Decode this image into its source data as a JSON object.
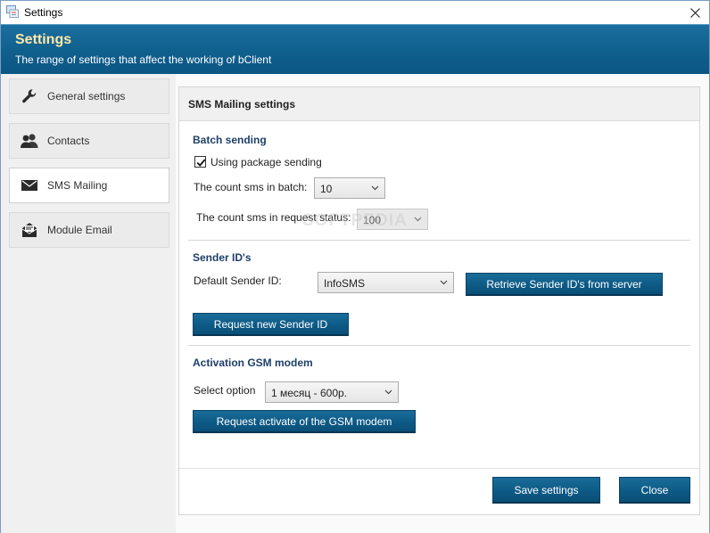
{
  "window": {
    "title": "Settings"
  },
  "banner": {
    "title": "Settings",
    "subtitle": "The range of settings that affect the working of bClient"
  },
  "sidebar": {
    "items": [
      {
        "label": "General settings",
        "icon": "wrench-icon",
        "active": false
      },
      {
        "label": "Contacts",
        "icon": "contacts-icon",
        "active": false
      },
      {
        "label": "SMS Mailing",
        "icon": "envelope-icon",
        "active": true
      },
      {
        "label": "Module Email",
        "icon": "email-module-icon",
        "active": false
      }
    ]
  },
  "panel": {
    "header": "SMS Mailing settings",
    "batch": {
      "title": "Batch sending",
      "use_package_label": "Using package sending",
      "use_package_checked": true,
      "count_batch_label": "The count sms in batch:",
      "count_batch_value": "10",
      "count_status_label": "The count sms in request status:",
      "count_status_value": "100"
    },
    "sender": {
      "title": "Sender ID's",
      "default_label": "Default Sender ID:",
      "default_value": "InfoSMS",
      "retrieve_button": "Retrieve Sender ID's from server",
      "request_button": "Request new Sender ID"
    },
    "gsm": {
      "title": "Activation GSM modem",
      "select_label": "Select option",
      "select_value": "1 месяц - 600р.",
      "activate_button": "Request activate of the GSM modem"
    },
    "footer": {
      "save_button": "Save settings",
      "close_button": "Close"
    }
  },
  "watermark": "SOFTPEDIA",
  "colors": {
    "accent": "#0d5a86",
    "banner_title": "#ffe9a8",
    "section_title": "#1e3f6a"
  }
}
